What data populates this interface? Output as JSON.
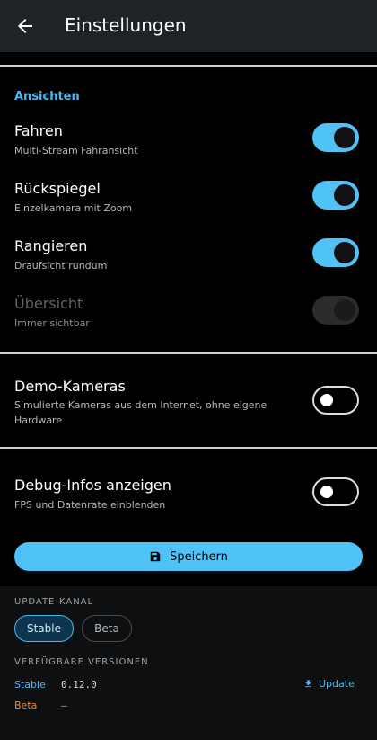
{
  "header": {
    "title": "Einstellungen",
    "back_icon": "arrow-left-icon"
  },
  "ansichten": {
    "section_label": "Ansichten",
    "items": [
      {
        "title": "Fahren",
        "subtitle": "Multi-Stream Fahransicht",
        "enabled": true,
        "disabled": false
      },
      {
        "title": "Rückspiegel",
        "subtitle": "Einzelkamera mit Zoom",
        "enabled": true,
        "disabled": false
      },
      {
        "title": "Rangieren",
        "subtitle": "Draufsicht rundum",
        "enabled": true,
        "disabled": false
      },
      {
        "title": "Übersicht",
        "subtitle": "Immer sichtbar",
        "enabled": true,
        "disabled": true
      }
    ]
  },
  "demo": {
    "title": "Demo-Kameras",
    "subtitle": "Simulierte Kameras aus dem Internet, ohne eigene Hardware",
    "enabled": false
  },
  "debug": {
    "title": "Debug-Infos anzeigen",
    "subtitle": "FPS und Datenrate einblenden",
    "enabled": false
  },
  "save": {
    "label": "Speichern",
    "icon": "save-icon"
  },
  "update_channel": {
    "label": "UPDATE-KANAL",
    "options": [
      "Stable",
      "Beta"
    ],
    "selected": "Stable"
  },
  "versions": {
    "label": "VERFÜGBARE VERSIONEN",
    "rows": [
      {
        "name": "Stable",
        "version": "0.12.0",
        "color": "#4fb8ef",
        "action": "Update"
      },
      {
        "name": "Beta",
        "version": "—",
        "color": "#ef8a3c",
        "action": ""
      }
    ],
    "update_icon": "download-icon"
  },
  "colors": {
    "accent": "#4fc3f7",
    "beta": "#ef8a3c"
  }
}
